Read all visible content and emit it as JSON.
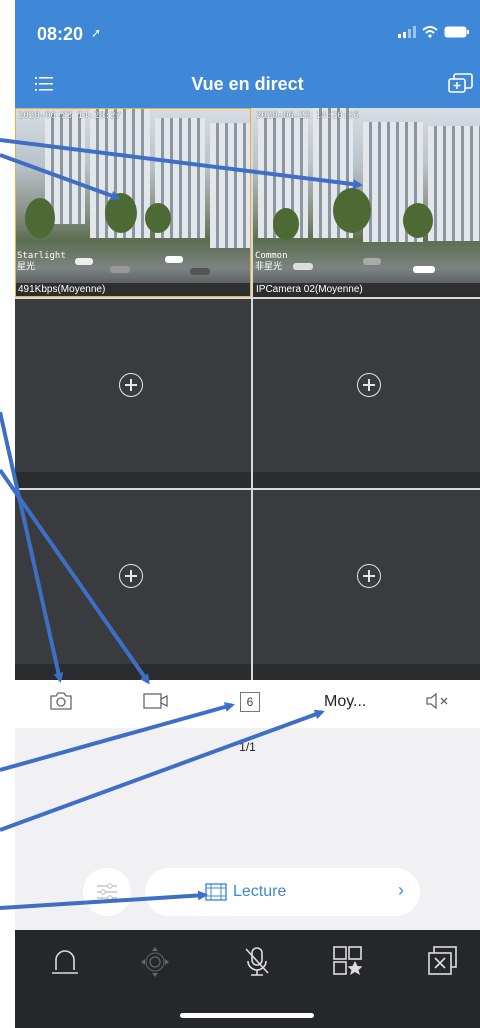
{
  "status": {
    "time": "08:20"
  },
  "nav": {
    "title": "Vue en direct"
  },
  "cells": [
    {
      "osd": "2020-06-23 14:20:27",
      "side": [
        "Starlight",
        "星光"
      ],
      "bitrate": "491Kbps(Moyenne)"
    },
    {
      "osd": "2020-06-23 14:20:26",
      "side": [
        "Common",
        "非星光"
      ],
      "bitrate": "IPCamera 02(Moyenne)"
    }
  ],
  "toolbar": {
    "channels": "6",
    "quality": "Moy..."
  },
  "page_indicator": "1/1",
  "playback": {
    "label": "Lecture"
  },
  "colors": {
    "accent": "#3f88d8",
    "arrow": "#3e6fc6",
    "dock": "#26272a"
  }
}
